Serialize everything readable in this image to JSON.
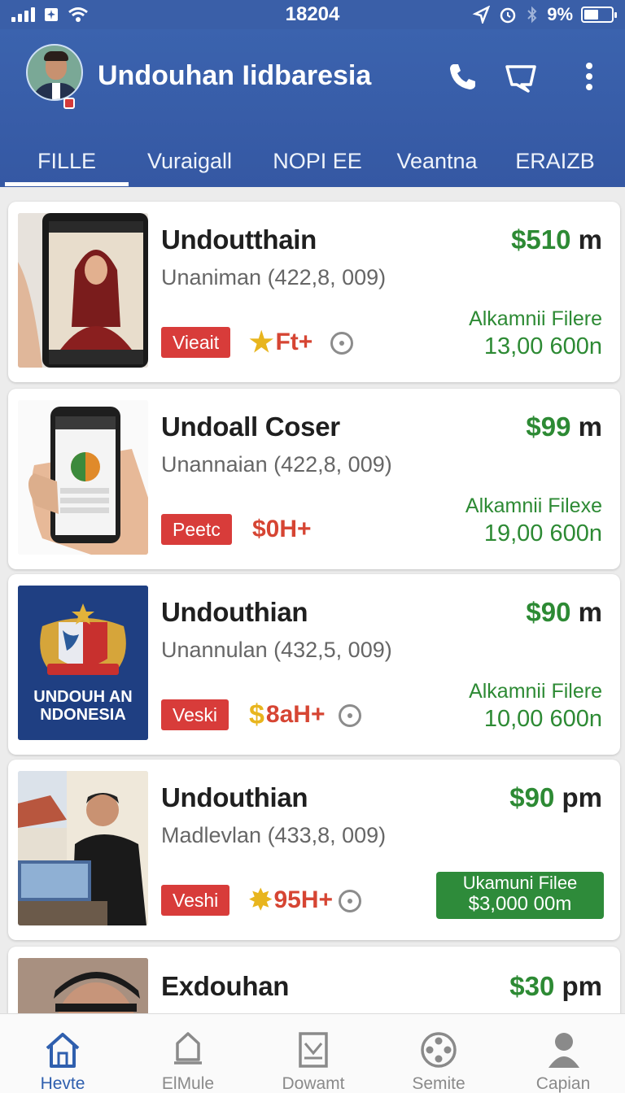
{
  "status_bar": {
    "time": "18204",
    "battery": "9%",
    "battery_level": 0.09
  },
  "header": {
    "title": "Undouhan Iidbaresia",
    "tabs": [
      {
        "label": "FILLE",
        "active": true
      },
      {
        "label": "Vuraigall"
      },
      {
        "label": "NOPI EE"
      },
      {
        "label": "Veantna"
      },
      {
        "label": "ERAIZB"
      }
    ]
  },
  "items": [
    {
      "title": "Undoutthain",
      "subtitle": "Unaniman (422,8, 009)",
      "price": "$510",
      "price_unit": "m",
      "tag": "Vieait",
      "rating": "Ft+",
      "dl_label": "Alkamnii Filere",
      "dl_value": "13,00 600n"
    },
    {
      "title": "Undoall Coser",
      "subtitle": "Unannaian (422,8, 009)",
      "price": "$99",
      "price_unit": "m",
      "tag": "Peetc",
      "rating": "$0H+",
      "dl_label": "Alkamnii Filexe",
      "dl_value": "19,00 600n"
    },
    {
      "title": "Undouthian",
      "subtitle": "Unannulan (432,5, 009)",
      "price": "$90",
      "price_unit": "m",
      "tag": "Veski",
      "rating": "8aH+",
      "dl_label": "Alkamnii Filere",
      "dl_value": "10,00 600n",
      "thumb_text_1": "UNDOUH AN",
      "thumb_text_2": "NDONESIA"
    },
    {
      "title": "Undouthian",
      "subtitle": "Madlevlan (433,8, 009)",
      "price": "$90",
      "price_unit": "pm",
      "tag": "Veshi",
      "rating": "95H+",
      "dl_label": "Ukamuni Filee",
      "dl_value": "$3,000 00m"
    },
    {
      "title": "Exdouhan",
      "price": "$30",
      "price_unit": "pm"
    }
  ],
  "bottom_nav": [
    {
      "label": "Hevte",
      "icon": "home-icon",
      "active": true
    },
    {
      "label": "ElMule",
      "icon": "bell-icon"
    },
    {
      "label": "Dowamt",
      "icon": "download-icon"
    },
    {
      "label": "Semite",
      "icon": "reel-icon"
    },
    {
      "label": "Capian",
      "icon": "person-icon"
    }
  ],
  "colors": {
    "primary": "#3b63ae",
    "price_green": "#2d8a34",
    "tag_red": "#d83c3a",
    "star_yellow": "#e8b51e"
  }
}
